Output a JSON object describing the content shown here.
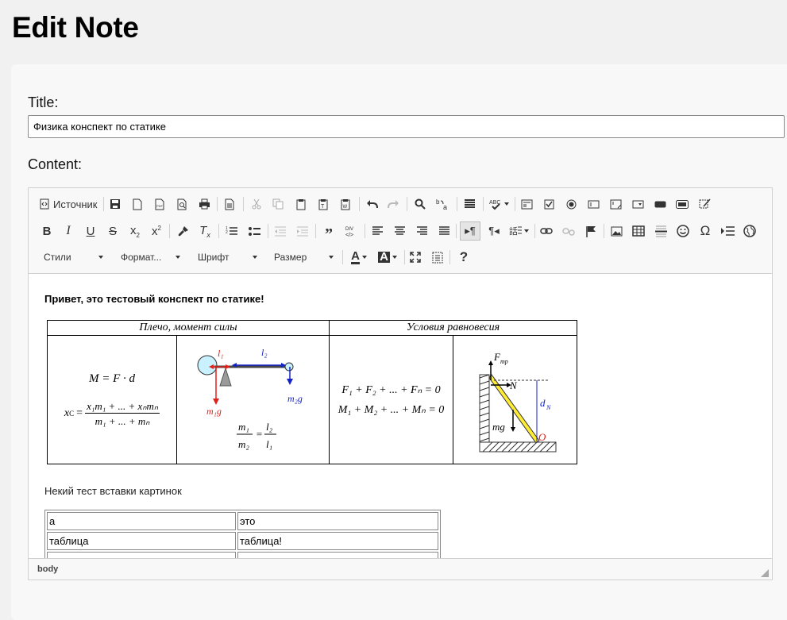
{
  "page": {
    "title": "Edit Note"
  },
  "form": {
    "title_label": "Title:",
    "title_value": "Физика конспект по статике",
    "content_label": "Content:"
  },
  "toolbar": {
    "source_label": "Источник",
    "styles_label": "Стили",
    "format_label": "Формат...",
    "font_label": "Шрифт",
    "size_label": "Размер"
  },
  "content": {
    "intro": "Привет, это тестовый конспект по статике!",
    "table_headers": [
      "Плечо, момент силы",
      "Условия равновесия"
    ],
    "formulas": {
      "moment": "M = F · d",
      "center_lhs": "x",
      "center_sub": "C",
      "center_num": "x₁m₁ + ... + xₙmₙ",
      "center_den": "m₁ + ... + mₙ",
      "l1": "l₁",
      "l2": "l₂",
      "m1g": "m₁g",
      "m2g": "m₂g",
      "ratio_lhs_num": "m₁",
      "ratio_lhs_den": "m₂",
      "ratio_rhs_num": "l₂",
      "ratio_rhs_den": "l₁",
      "force_sum": "F₁ + F₂ + ... + Fₙ = 0",
      "moment_sum": "M₁ + M₂ + ... + Mₙ = 0",
      "ftr": "F",
      "ftr_sub": "тр",
      "n_label": "N",
      "mg_label": "mg",
      "d_label": "d",
      "d_sub": "N",
      "o_label": "O"
    },
    "image_caption": "Некий тест вставки картинок",
    "table_rows": [
      [
        "а",
        "это"
      ],
      [
        "таблица",
        "таблица!"
      ],
      [
        "",
        ""
      ]
    ]
  },
  "status": {
    "path": "body"
  },
  "colors": {
    "red": "#e0201a",
    "blue": "#1522c8",
    "yellow": "#ffec35"
  }
}
